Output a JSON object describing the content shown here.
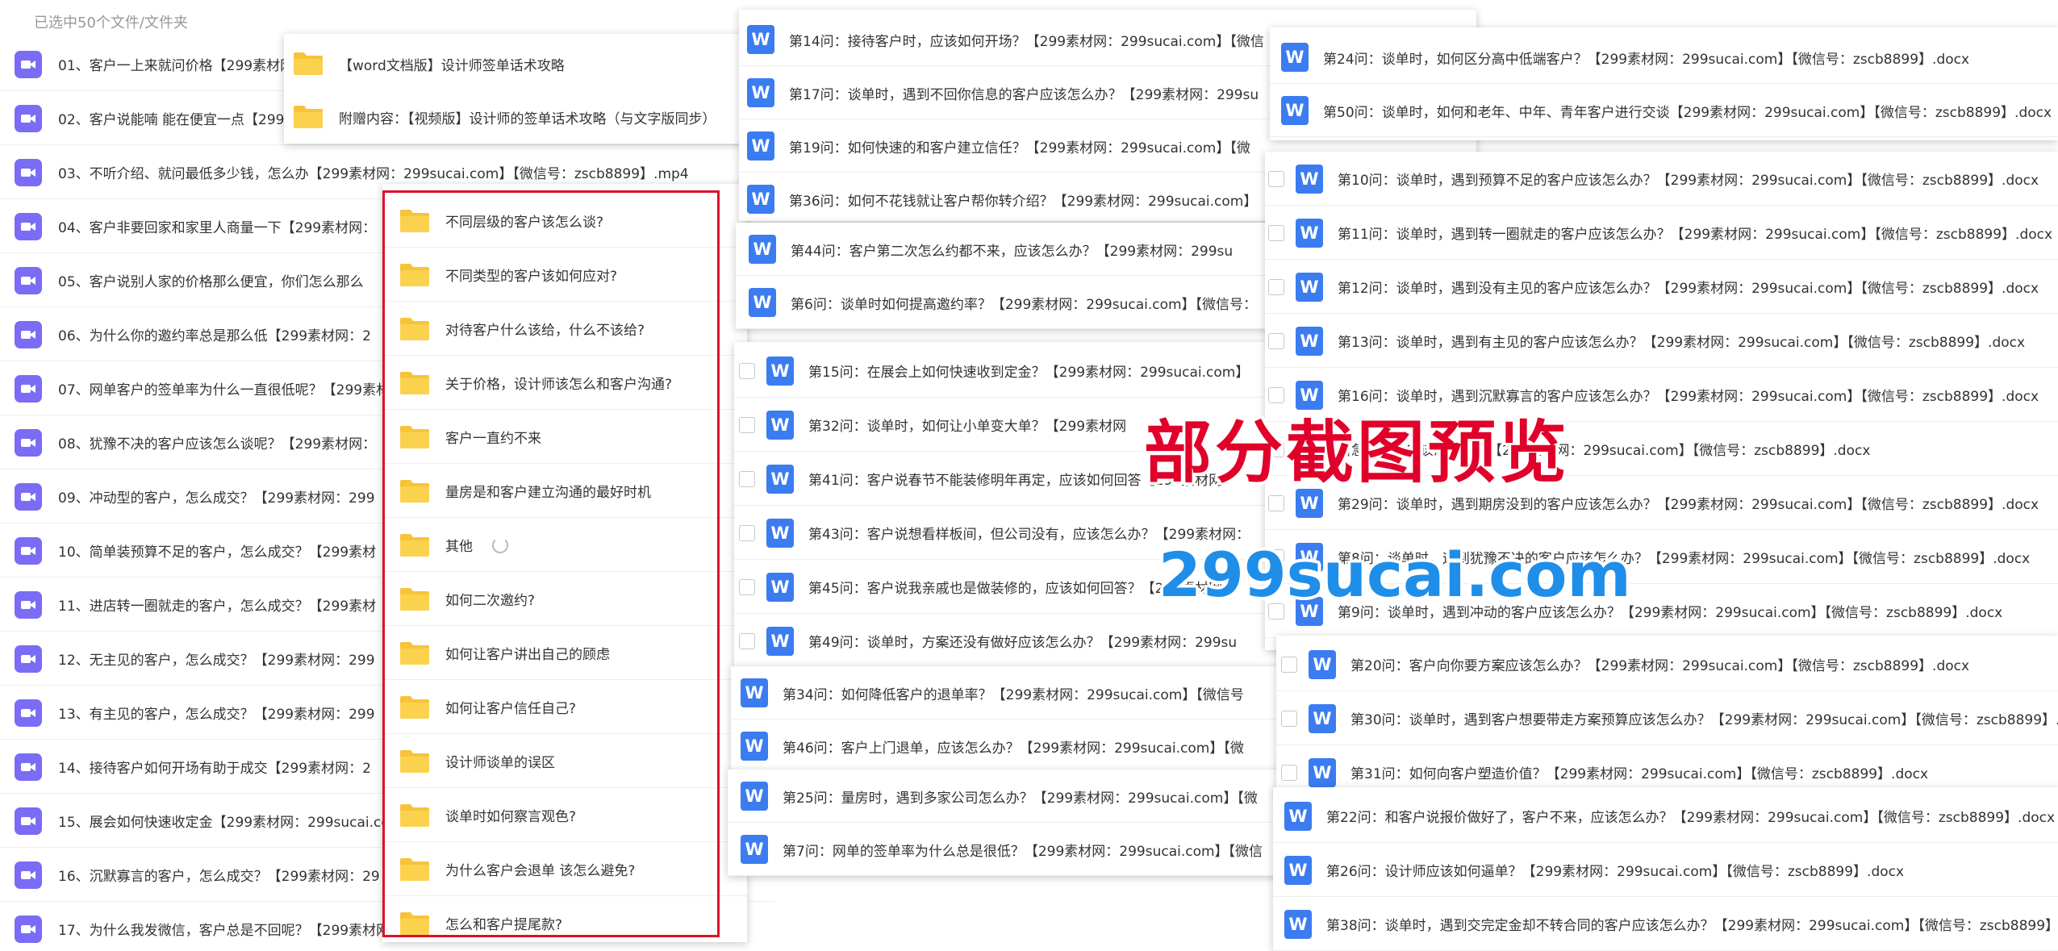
{
  "header": {
    "selection": "已选中50个文件/文件夹"
  },
  "video_list": [
    "01、客户一上来就问价格【299素材网",
    "02、客户说能喃 能在便宜一点【299",
    "03、不听介绍、就问最低多少钱，怎么办【299素材网：299sucai.com】【微信号：zscb8899】.mp4",
    "04、客户非要回家和家里人商量一下【299素材网：",
    "05、客户说别人家的价格那么便宜，你们怎么那么",
    "06、为什么你的邀约率总是那么低【299素材网：2",
    "07、网单客户的签单率为什么一直很低呢？【299素材网",
    "08、犹豫不决的客户应该怎么谈呢？【299素材网：",
    "09、冲动型的客户，怎么成交？【299素材网：299",
    "10、简单装预算不足的客户，怎么成交？【299素材",
    "11、进店转一圈就走的客户，怎么成交？【299素材",
    "12、无主见的客户，怎么成交？【299素材网：299",
    "13、有主见的客户，怎么成交？【299素材网：299",
    "14、接待客户如何开场有助于成交【299素材网：2",
    "15、展会如何快速收定金【299素材网：299sucai.co",
    "16、沉默寡言的客户，怎么成交？【299素材网：29",
    "17、为什么我发微信，客户总是不回呢？【299素材网"
  ],
  "top_folders": [
    "【word文档版】设计师签单话术攻略",
    "附赠内容：【视频版】设计师的签单话术攻略（与文字版同步）"
  ],
  "folder_list": [
    "不同层级的客户该怎么谈?",
    "不同类型的客户该如何应对?",
    "对待客户什么该给，什么不该给?",
    "关于价格，设计师该怎么和客户沟通?",
    "客户一直约不来",
    "量房是和客户建立沟通的最好时机",
    "其他",
    "如何二次邀约?",
    "如何让客户讲出自己的顾虑",
    "如何让客户信任自己?",
    "设计师谈单的误区",
    "谈单时如何察言观色?",
    "为什么客户会退单 该怎么避免?",
    "怎么和客户提尾款?"
  ],
  "doc_group_a": [
    "第14问：接待客户时，应该如何开场？【299素材网：299sucai.com】【微信",
    "第17问：谈单时，遇到不回你信息的客户应该怎么办？【299素材网：299su",
    "第19问：如何快速的和客户建立信任？【299素材网：299sucai.com】【微",
    "第36问：如何不花钱就让客户帮你转介绍？【299素材网：299sucai.com】"
  ],
  "doc_group_b": [
    "第44问：客户第二次怎么约都不来，应该怎么办？【299素材网：299su",
    "第6问：谈单时如何提高邀约率？【299素材网：299sucai.com】【微信号："
  ],
  "doc_group_c": [
    "第15问：在展会上如何快速收到定金？【299素材网：299sucai.com】",
    "第32问：谈单时，如何让小单变大单？【299素材网",
    "第41问：客户说春节不能装修明年再定，应该如何回答【299素材网：",
    "第43问：客户说想看样板间，但公司没有，应该怎么办？【299素材网：",
    "第45问：客户说我亲戚也是做装修的，应该如何回答？【299素材网：",
    "第49问：谈单时，方案还没有做好应该怎么办？【299素材网：299su"
  ],
  "doc_group_d": [
    "第34问：如何降低客户的退单率？【299素材网：299sucai.com】【微信号",
    "第46问：客户上门退单，应该怎么办？【299素材网：299sucai.com】【微"
  ],
  "doc_group_e": [
    "第25问：量房时，遇到多家公司怎么办？【299素材网：299sucai.com】【微",
    "第7问：网单的签单率为什么总是很低？【299素材网：299sucai.com】【微信"
  ],
  "doc_group_f": [
    "第24问：谈单时，如何区分高中低端客户？【299素材网：299sucai.com】【微信号：zscb8899】.docx",
    "第50问：谈单时，如何和老年、中年、青年客户进行交谈【299素材网：299sucai.com】【微信号：zscb8899】.docx"
  ],
  "doc_group_g": [
    "第10问：谈单时，遇到预算不足的客户应该怎么办？【299素材网：299sucai.com】【微信号：zscb8899】.docx",
    "第11问：谈单时，遇到转一圈就走的客户应该怎么办？【299素材网：299sucai.com】【微信号：zscb8899】.docx",
    "第12问：谈单时，遇到没有主见的客户应该怎么办？【299素材网：299sucai.com】【微信号：zscb8899】.docx",
    "第13问：谈单时，遇到有主见的客户应该怎么办？【299素材网：299sucai.com】【微信号：zscb8899】.docx",
    "第16问：谈单时，遇到沉默寡言的客户应该怎么办？【299素材网：299sucai.com】【微信号：zscb8899】.docx",
    "着急的客户应该怎么办？【299素材网：299sucai.com】【微信号：zscb8899】.docx",
    "第29问：谈单时，遇到期房没到的客户应该怎么办？【299素材网：299sucai.com】【微信号：zscb8899】.docx",
    "第8问：谈单时，遇到犹豫不决的客户应该怎么办？【299素材网：299sucai.com】【微信号：zscb8899】.docx",
    "第9问：谈单时，遇到冲动的客户应该怎么办？【299素材网：299sucai.com】【微信号：zscb8899】.docx"
  ],
  "doc_group_h": [
    "第20问：客户向你要方案应该怎么办？【299素材网：299sucai.com】【微信号：zscb8899】.docx",
    "第30问：谈单时，遇到客户想要带走方案预算应该怎么办？【299素材网：299sucai.com】【微信号：zscb8899】.docx",
    "第31问：如何向客户塑造价值？【299素材网：299sucai.com】【微信号：zscb8899】.docx"
  ],
  "doc_group_i": [
    "第22问：和客户说报价做好了，客户不来，应该怎么办？【299素材网：299sucai.com】【微信号：zscb8899】.docx",
    "第26问：设计师应该如何逼单？【299素材网：299sucai.com】【微信号：zscb8899】.docx",
    "第38问：谈单时，遇到交完定金却不转合同的客户应该怎么办？【299素材网：299sucai.com】【微信号：zscb8899】.docx"
  ],
  "watermark": {
    "title": "部分截图预览",
    "site": "299sucai.com"
  },
  "colors": {
    "video_icon": "#7b6cf6",
    "word_icon": "#3b7cf0",
    "folder": "#f7c33a",
    "highlight_border": "#e0102a"
  }
}
